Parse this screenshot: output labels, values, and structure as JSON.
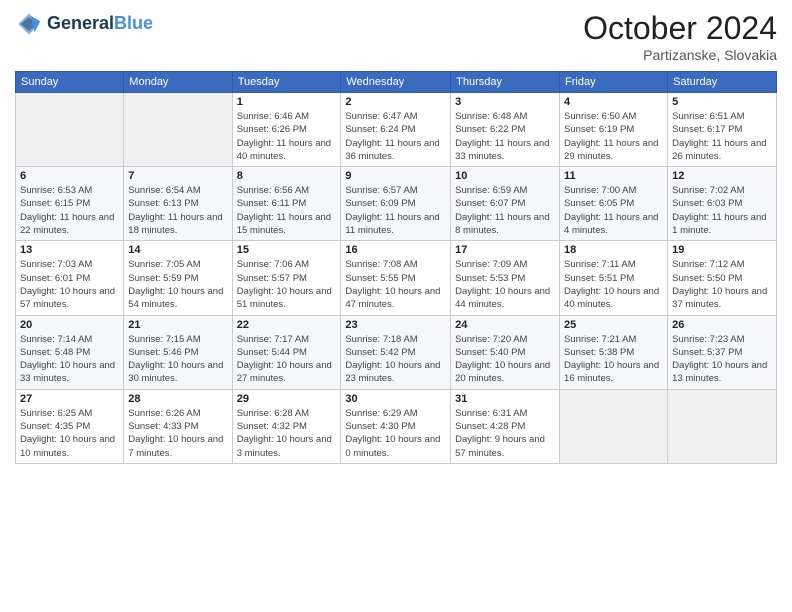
{
  "header": {
    "logo_line1": "General",
    "logo_line2": "Blue",
    "month": "October 2024",
    "location": "Partizanske, Slovakia"
  },
  "weekdays": [
    "Sunday",
    "Monday",
    "Tuesday",
    "Wednesday",
    "Thursday",
    "Friday",
    "Saturday"
  ],
  "weeks": [
    [
      {
        "day": "",
        "info": ""
      },
      {
        "day": "",
        "info": ""
      },
      {
        "day": "1",
        "info": "Sunrise: 6:46 AM\nSunset: 6:26 PM\nDaylight: 11 hours and 40 minutes."
      },
      {
        "day": "2",
        "info": "Sunrise: 6:47 AM\nSunset: 6:24 PM\nDaylight: 11 hours and 36 minutes."
      },
      {
        "day": "3",
        "info": "Sunrise: 6:48 AM\nSunset: 6:22 PM\nDaylight: 11 hours and 33 minutes."
      },
      {
        "day": "4",
        "info": "Sunrise: 6:50 AM\nSunset: 6:19 PM\nDaylight: 11 hours and 29 minutes."
      },
      {
        "day": "5",
        "info": "Sunrise: 6:51 AM\nSunset: 6:17 PM\nDaylight: 11 hours and 26 minutes."
      }
    ],
    [
      {
        "day": "6",
        "info": "Sunrise: 6:53 AM\nSunset: 6:15 PM\nDaylight: 11 hours and 22 minutes."
      },
      {
        "day": "7",
        "info": "Sunrise: 6:54 AM\nSunset: 6:13 PM\nDaylight: 11 hours and 18 minutes."
      },
      {
        "day": "8",
        "info": "Sunrise: 6:56 AM\nSunset: 6:11 PM\nDaylight: 11 hours and 15 minutes."
      },
      {
        "day": "9",
        "info": "Sunrise: 6:57 AM\nSunset: 6:09 PM\nDaylight: 11 hours and 11 minutes."
      },
      {
        "day": "10",
        "info": "Sunrise: 6:59 AM\nSunset: 6:07 PM\nDaylight: 11 hours and 8 minutes."
      },
      {
        "day": "11",
        "info": "Sunrise: 7:00 AM\nSunset: 6:05 PM\nDaylight: 11 hours and 4 minutes."
      },
      {
        "day": "12",
        "info": "Sunrise: 7:02 AM\nSunset: 6:03 PM\nDaylight: 11 hours and 1 minute."
      }
    ],
    [
      {
        "day": "13",
        "info": "Sunrise: 7:03 AM\nSunset: 6:01 PM\nDaylight: 10 hours and 57 minutes."
      },
      {
        "day": "14",
        "info": "Sunrise: 7:05 AM\nSunset: 5:59 PM\nDaylight: 10 hours and 54 minutes."
      },
      {
        "day": "15",
        "info": "Sunrise: 7:06 AM\nSunset: 5:57 PM\nDaylight: 10 hours and 51 minutes."
      },
      {
        "day": "16",
        "info": "Sunrise: 7:08 AM\nSunset: 5:55 PM\nDaylight: 10 hours and 47 minutes."
      },
      {
        "day": "17",
        "info": "Sunrise: 7:09 AM\nSunset: 5:53 PM\nDaylight: 10 hours and 44 minutes."
      },
      {
        "day": "18",
        "info": "Sunrise: 7:11 AM\nSunset: 5:51 PM\nDaylight: 10 hours and 40 minutes."
      },
      {
        "day": "19",
        "info": "Sunrise: 7:12 AM\nSunset: 5:50 PM\nDaylight: 10 hours and 37 minutes."
      }
    ],
    [
      {
        "day": "20",
        "info": "Sunrise: 7:14 AM\nSunset: 5:48 PM\nDaylight: 10 hours and 33 minutes."
      },
      {
        "day": "21",
        "info": "Sunrise: 7:15 AM\nSunset: 5:46 PM\nDaylight: 10 hours and 30 minutes."
      },
      {
        "day": "22",
        "info": "Sunrise: 7:17 AM\nSunset: 5:44 PM\nDaylight: 10 hours and 27 minutes."
      },
      {
        "day": "23",
        "info": "Sunrise: 7:18 AM\nSunset: 5:42 PM\nDaylight: 10 hours and 23 minutes."
      },
      {
        "day": "24",
        "info": "Sunrise: 7:20 AM\nSunset: 5:40 PM\nDaylight: 10 hours and 20 minutes."
      },
      {
        "day": "25",
        "info": "Sunrise: 7:21 AM\nSunset: 5:38 PM\nDaylight: 10 hours and 16 minutes."
      },
      {
        "day": "26",
        "info": "Sunrise: 7:23 AM\nSunset: 5:37 PM\nDaylight: 10 hours and 13 minutes."
      }
    ],
    [
      {
        "day": "27",
        "info": "Sunrise: 6:25 AM\nSunset: 4:35 PM\nDaylight: 10 hours and 10 minutes."
      },
      {
        "day": "28",
        "info": "Sunrise: 6:26 AM\nSunset: 4:33 PM\nDaylight: 10 hours and 7 minutes."
      },
      {
        "day": "29",
        "info": "Sunrise: 6:28 AM\nSunset: 4:32 PM\nDaylight: 10 hours and 3 minutes."
      },
      {
        "day": "30",
        "info": "Sunrise: 6:29 AM\nSunset: 4:30 PM\nDaylight: 10 hours and 0 minutes."
      },
      {
        "day": "31",
        "info": "Sunrise: 6:31 AM\nSunset: 4:28 PM\nDaylight: 9 hours and 57 minutes."
      },
      {
        "day": "",
        "info": ""
      },
      {
        "day": "",
        "info": ""
      }
    ]
  ]
}
